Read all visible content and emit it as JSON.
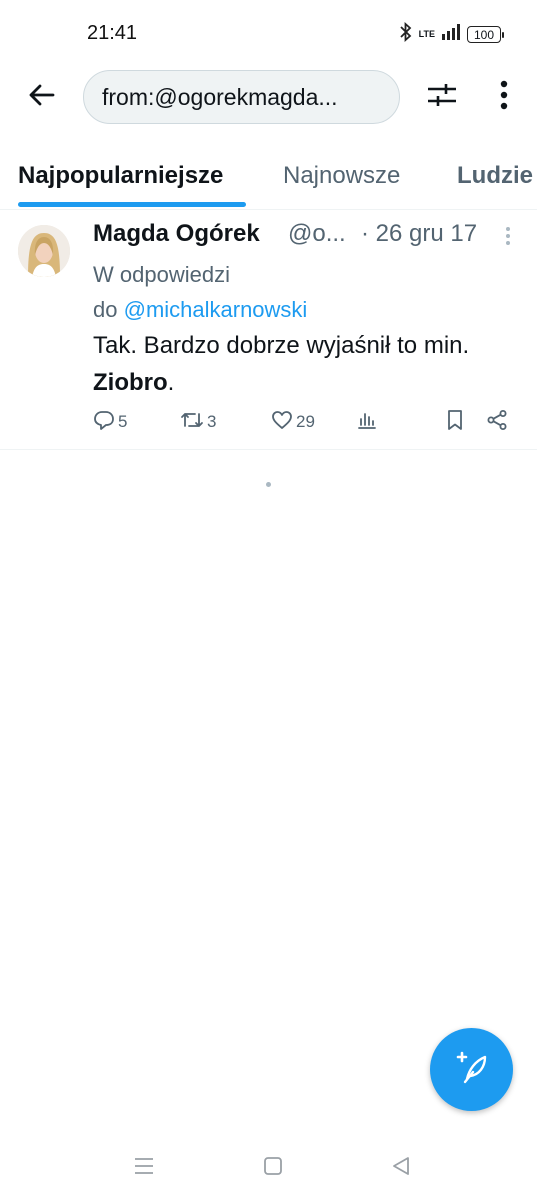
{
  "status_bar": {
    "time": "21:41",
    "network_label": "LTE",
    "battery": "100",
    "icons": [
      "bluetooth-icon",
      "signal-icon",
      "battery-icon"
    ]
  },
  "header": {
    "search_query": "from:@ogorekmagda...",
    "icons": [
      "back-arrow-icon",
      "filter-sliders-icon",
      "more-vertical-icon"
    ]
  },
  "tabs": [
    {
      "label": "Najpopularniejsze",
      "active": true
    },
    {
      "label": "Najnowsze",
      "active": false
    },
    {
      "label": "Ludzie",
      "active": false
    }
  ],
  "tweet": {
    "author_name": "Magda Ogórek",
    "author_handle": "@o...",
    "date": "· 26 gru 17",
    "reply_prefix": "W odpowiedzi",
    "reply_do": "do",
    "reply_mention": "@michalkarnowski",
    "text_part1": "Tak. Bardzo dobrze wyjaśnił to min.",
    "text_bold": "Ziobro",
    "text_end": ".",
    "counts": {
      "replies": "5",
      "retweets": "3",
      "likes": "29"
    },
    "action_icons": [
      "reply-icon",
      "retweet-icon",
      "like-icon",
      "views-icon",
      "bookmark-icon",
      "share-icon"
    ]
  },
  "fab": {
    "icon": "compose-tweet-icon"
  },
  "nav_bar": {
    "icons": [
      "recents-icon",
      "home-icon",
      "back-icon"
    ]
  },
  "colors": {
    "accent": "#1d9bf0",
    "text_primary": "#0f1419",
    "text_secondary": "#536471",
    "divider": "#eff3f4"
  }
}
